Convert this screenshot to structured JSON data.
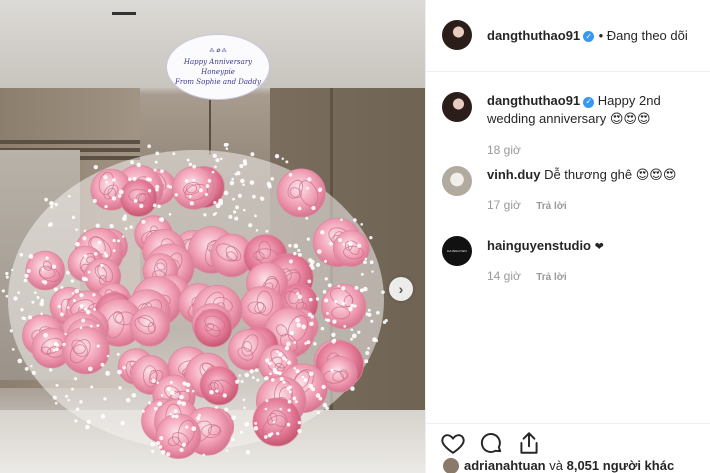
{
  "post": {
    "card": {
      "header": "⁂ ✿ ⁂",
      "line1": "Happy Anniversary Honeypie",
      "line2": "From Sophie and Daddy"
    },
    "next_icon": "chevron-right-icon"
  },
  "header": {
    "username": "dangthuthao91",
    "verified": "✓",
    "follow_status": "• Đang theo dõi"
  },
  "comments": [
    {
      "username": "dangthuthao91",
      "verified": "✓",
      "text": "Happy 2nd wedding anniversary 😍😍😍",
      "time": "18 giờ",
      "reply": ""
    },
    {
      "username": "vinh.duy",
      "text": "Dễ thương ghê 😍😍😍",
      "time": "17 giờ",
      "reply": "Trả lời"
    },
    {
      "username": "hainguyenstudio",
      "text": "❤",
      "time": "14 giờ",
      "reply": "Trả lời",
      "avatar_text": "HAINGUYEN"
    }
  ],
  "actions": {
    "like_icon": "heart-icon",
    "comment_icon": "comment-icon",
    "share_icon": "share-icon"
  },
  "likes": {
    "liker": "adrianahtuan",
    "connector": "và",
    "count": "8,051",
    "suffix": "người khác"
  },
  "colors": {
    "verified": "#3897f0",
    "rose": "#f2a3b8",
    "rose_dark": "#e57b98"
  }
}
